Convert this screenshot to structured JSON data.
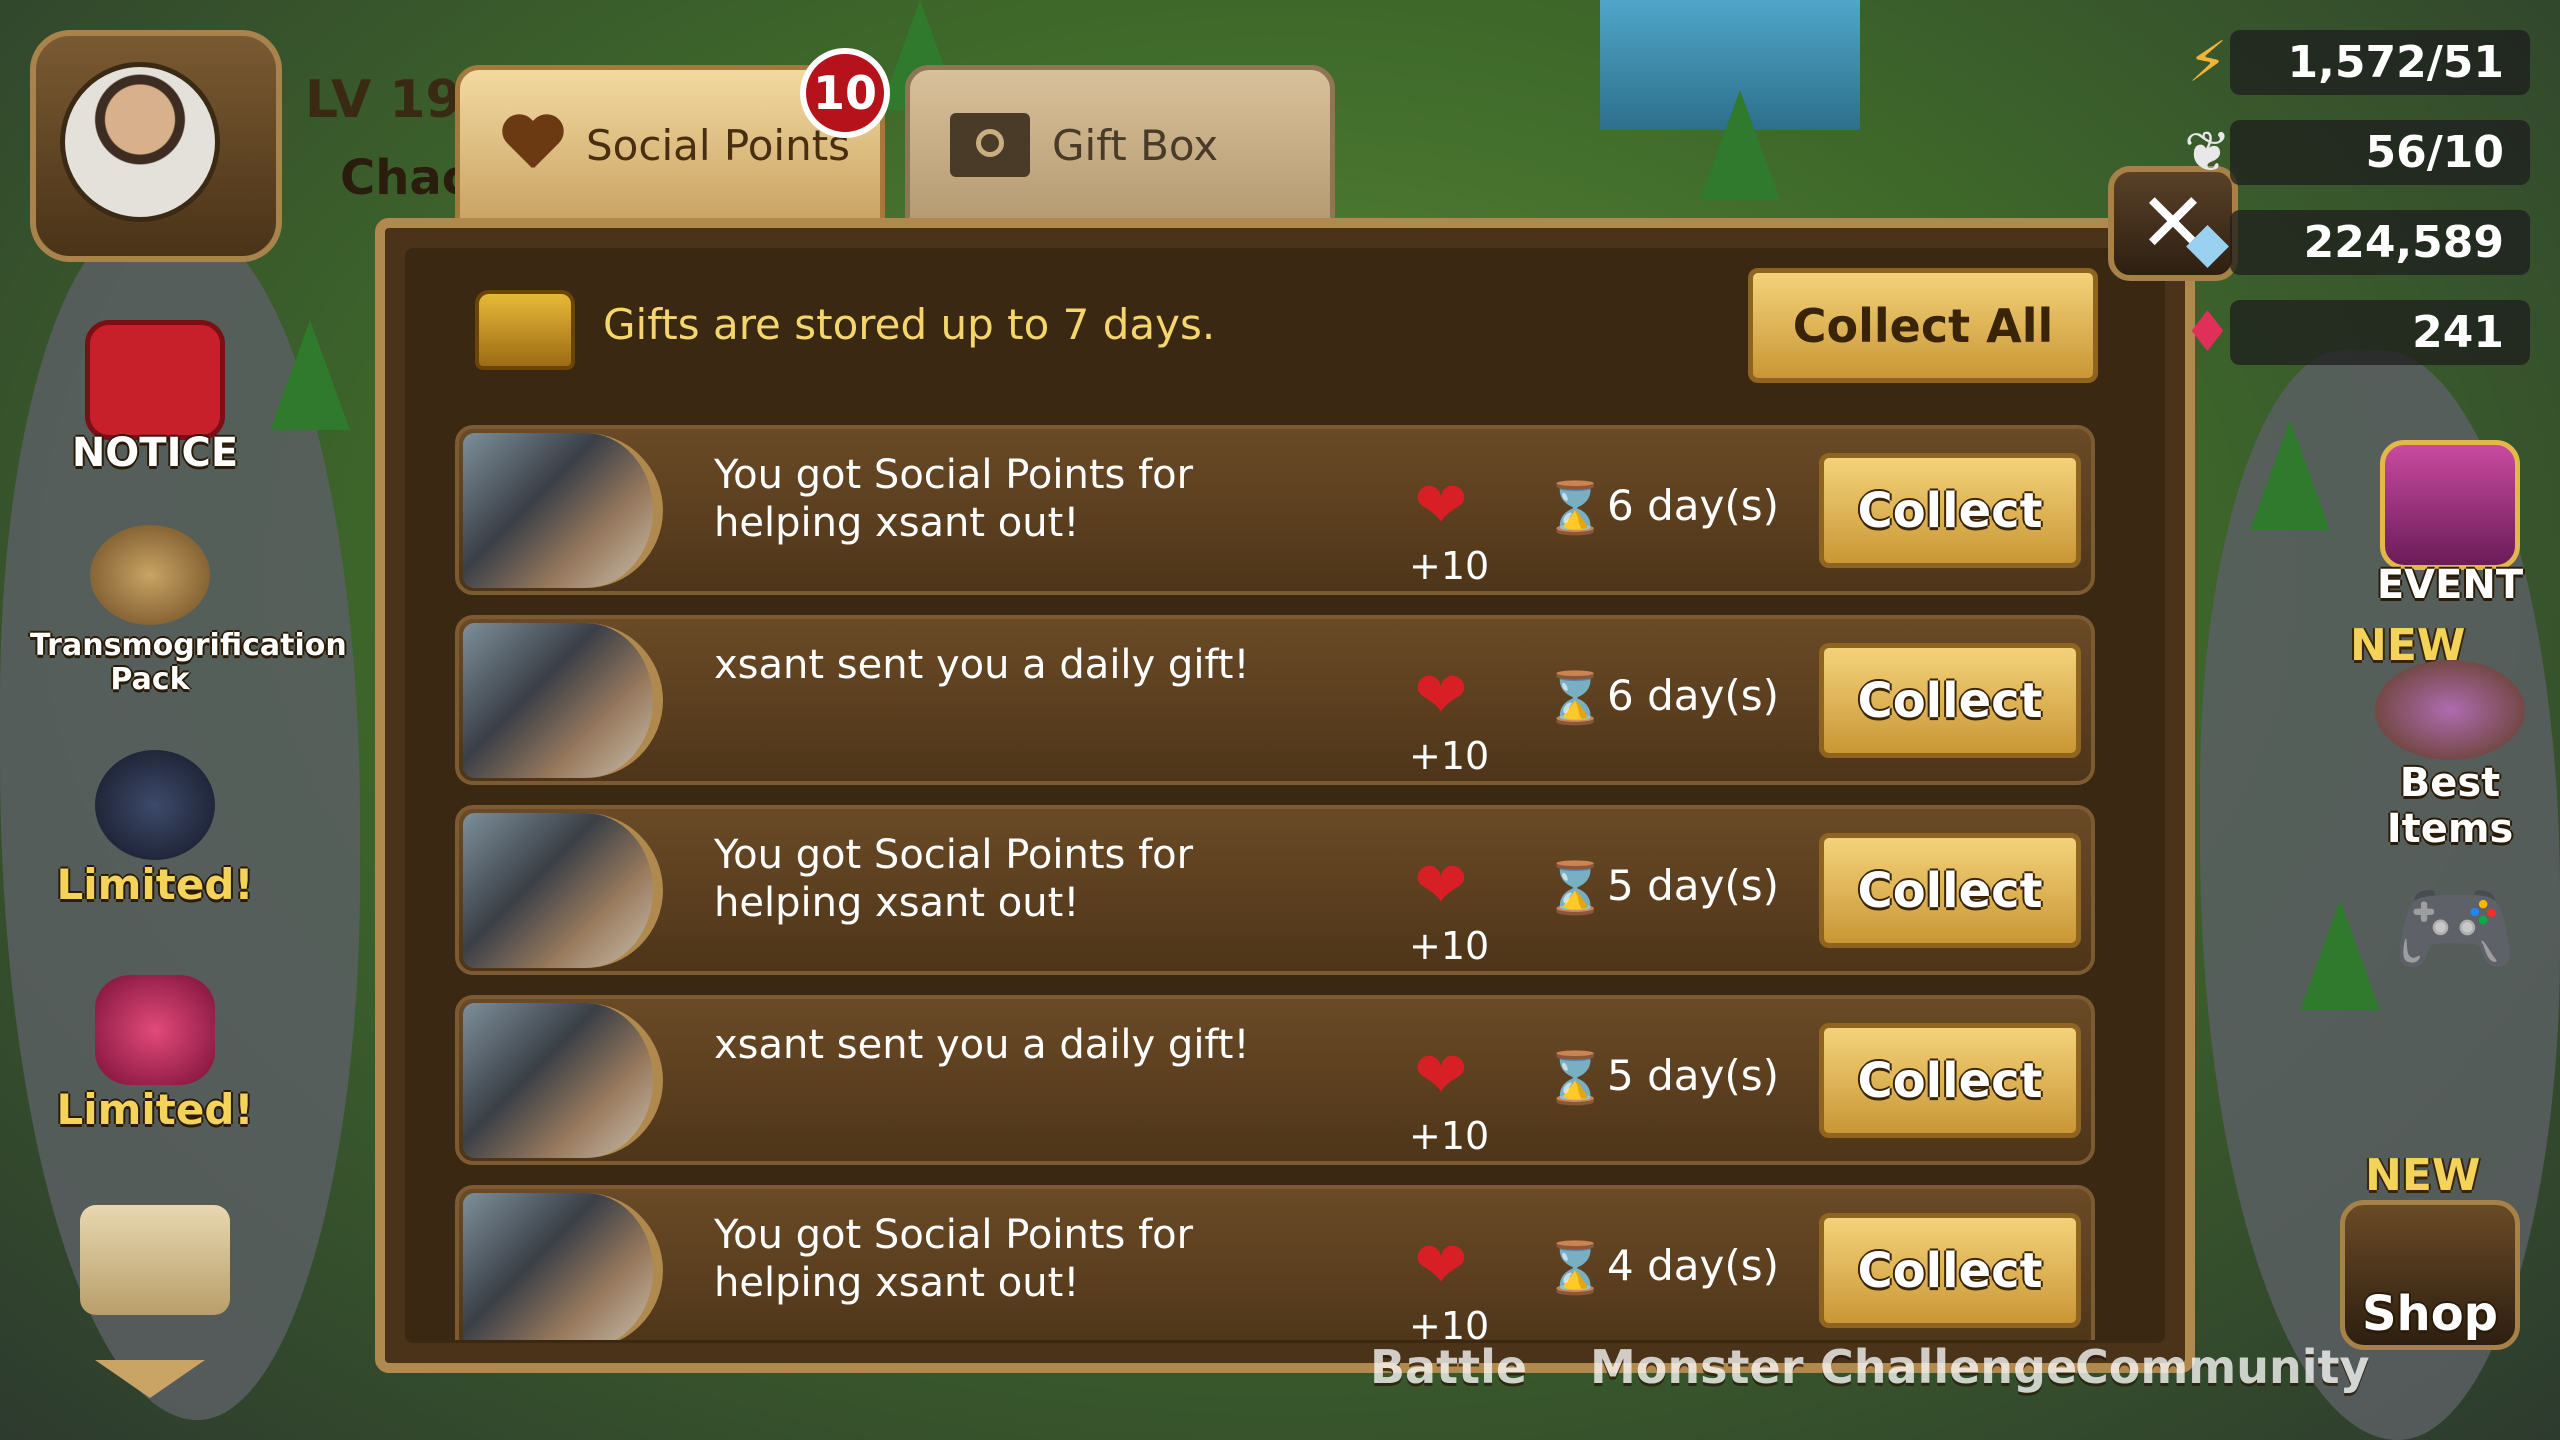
{
  "player": {
    "level_label": "LV 19",
    "name": "Chac"
  },
  "tabs": [
    {
      "label": "Social Points",
      "icon": "heart-icon",
      "active": true
    },
    {
      "label": "Gift Box",
      "icon": "gift-box-icon",
      "active": false
    }
  ],
  "social_badge": "10",
  "close_label": "✕",
  "storage_note": "Gifts are stored up to 7 days.",
  "collect_all_label": "Collect All",
  "gifts": [
    {
      "message": "You got Social Points for helping xsant out!",
      "points": "+10",
      "days": "6 day(s)",
      "button": "Collect"
    },
    {
      "message": "xsant sent you a daily gift!",
      "points": "+10",
      "days": "6 day(s)",
      "button": "Collect"
    },
    {
      "message": "You got Social Points for helping xsant out!",
      "points": "+10",
      "days": "5 day(s)",
      "button": "Collect"
    },
    {
      "message": "xsant sent you a daily gift!",
      "points": "+10",
      "days": "5 day(s)",
      "button": "Collect"
    },
    {
      "message": "You got Social Points for helping xsant out!",
      "points": "+10",
      "days": "4 day(s)",
      "button": "Collect"
    }
  ],
  "resources": [
    {
      "icon": "energy-icon",
      "value": "1,572/51"
    },
    {
      "icon": "wing-icon",
      "value": "56/10"
    },
    {
      "icon": "mana-icon",
      "value": "224,589"
    },
    {
      "icon": "crystal-icon",
      "value": "241"
    }
  ],
  "left_menu": [
    {
      "label": "NOTICE",
      "icon": "notice-icon"
    },
    {
      "label": "Transmogrification Pack",
      "icon": "transmogrification-icon"
    },
    {
      "label": "Limited!",
      "icon": "devilmon-icon"
    },
    {
      "label": "Limited!",
      "icon": "crystal-pack-icon"
    },
    {
      "label": "",
      "icon": "quest-scroll-icon"
    }
  ],
  "right_menu": {
    "event_label": "EVENT",
    "best_items_new": "NEW",
    "best_items_label": "Best Items",
    "shop_new": "NEW",
    "shop_label": "Shop"
  },
  "bottom_tabs": [
    "Battle",
    "Monster",
    "Challenge",
    "Community"
  ],
  "colors": {
    "accent_gold": "#f5d66c",
    "panel_brown": "#3b2812",
    "badge_red": "#b5121b"
  }
}
